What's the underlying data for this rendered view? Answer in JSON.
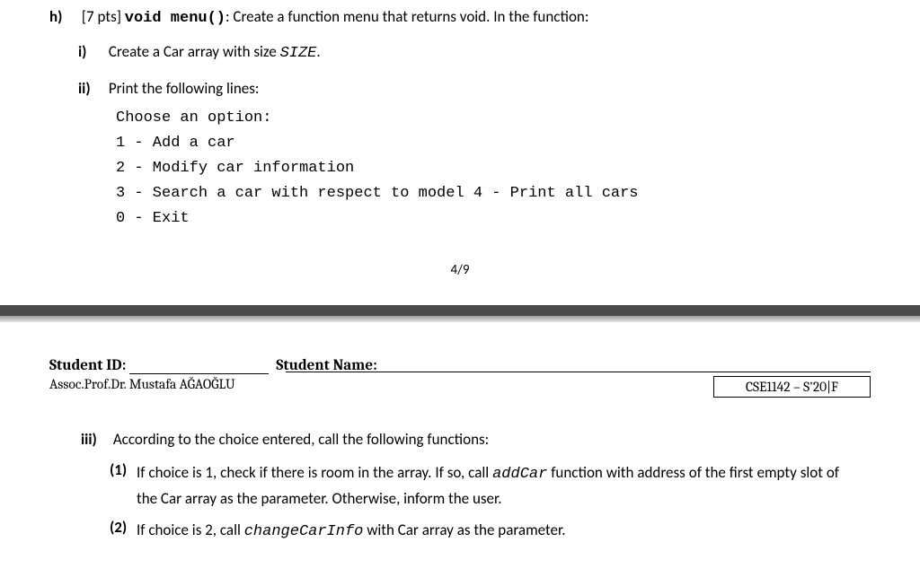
{
  "h": {
    "marker": "h)",
    "pts": "[7 pts]",
    "code": "void menu()",
    "text": ": Create a function menu that returns void. In the function:"
  },
  "i": {
    "marker": "i)",
    "text_a": "Create a Car array with size ",
    "size": "SIZE",
    "text_b": "."
  },
  "ii": {
    "marker": "ii)",
    "text": "Print the following lines:"
  },
  "code": {
    "l1": "Choose an option:",
    "l2": "1 - Add a car",
    "l3": "2 - Modify car information",
    "l4": "3 - Search a car with respect to model 4 - Print all cars",
    "l5": "0 - Exit"
  },
  "pagenum": "4/9",
  "header": {
    "sid_label": "Student ID:",
    "sname_label": "Student Name:",
    "prof": "Assoc.Prof.Dr. Mustafa AĞAOĞLU",
    "course": "CSE1142 – S'20|F"
  },
  "iii": {
    "marker": "iii)",
    "text": "According to the choice entered, call the following functions:"
  },
  "n1": {
    "marker": "(1)",
    "a": "If choice is 1, check if there is room in the array. If so, call ",
    "fn": "addCar",
    "b": " function with address of the first empty slot of the Car array as the parameter. Otherwise, inform the user."
  },
  "n2": {
    "marker": "(2)",
    "a": "If choice is 2, call ",
    "fn": "changeCarInfo",
    "b": " with Car array as the parameter."
  }
}
